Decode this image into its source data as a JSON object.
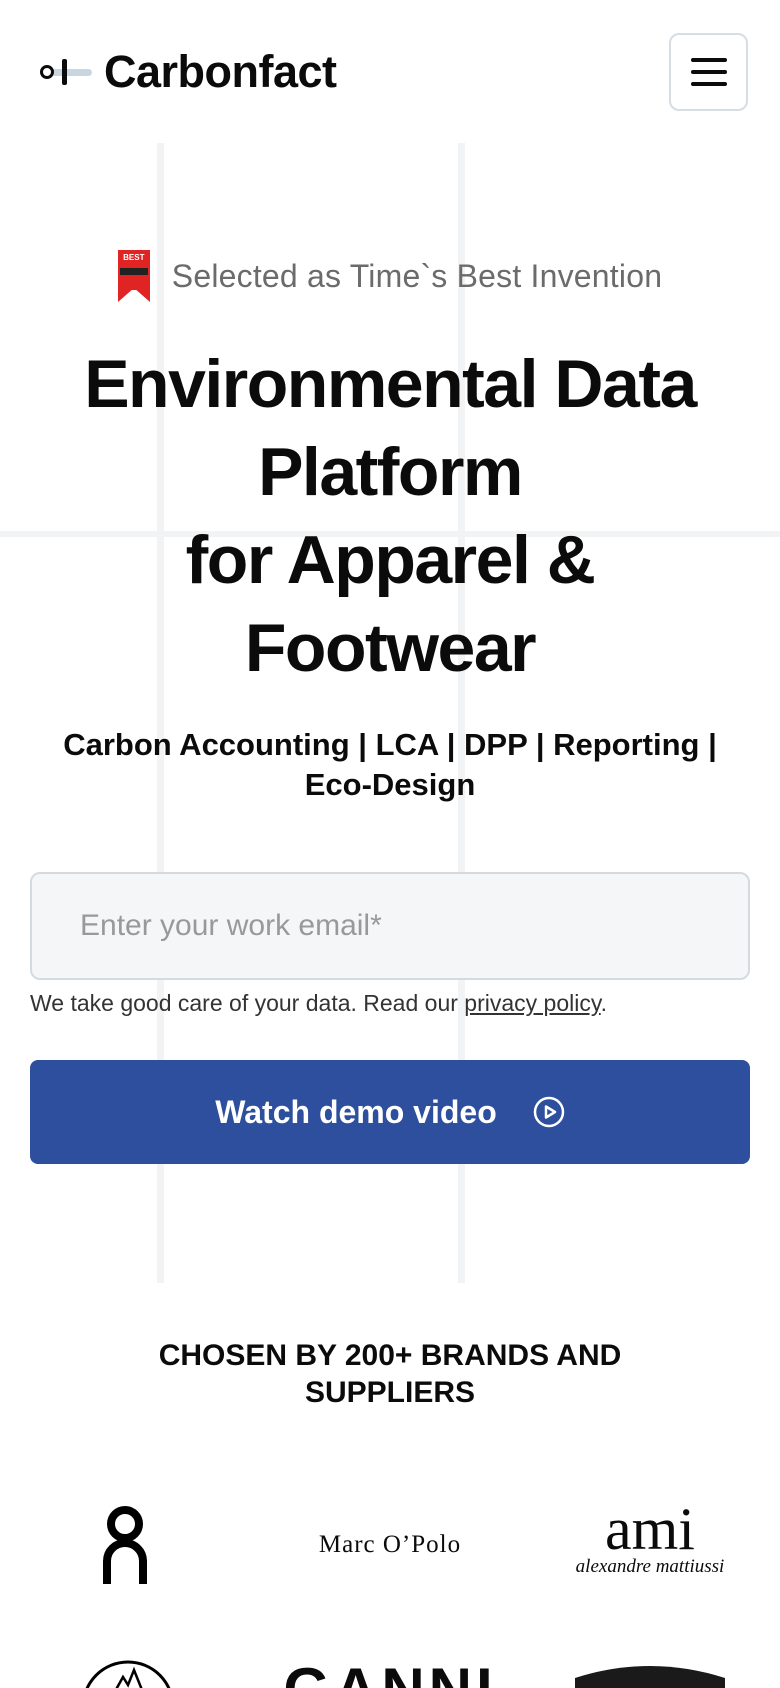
{
  "header": {
    "brand_name": "Carbonfact",
    "menu_icon": "hamburger-menu-icon"
  },
  "hero": {
    "badge_icon_text": "BEST",
    "badge_text": "Selected as Time`s Best Invention",
    "title_lines": [
      "Environmental Data",
      "Platform",
      "for Apparel &",
      "Footwear"
    ],
    "subtitle": "Carbon Accounting | LCA | DPP | Reporting | Eco-Design",
    "email_placeholder": "Enter your work email*",
    "privacy_prefix": "We take good care of your data. Read our ",
    "privacy_link": "privacy policy",
    "privacy_suffix": ".",
    "cta_label": "Watch demo video",
    "cta_icon": "play-circle-icon"
  },
  "brands": {
    "heading": "CHOSEN BY 200+ BRANDS AND SUPPLIERS",
    "logos": [
      {
        "name": "On",
        "text": ""
      },
      {
        "name": "Marc O'Polo",
        "text": "Marc O’Polo"
      },
      {
        "name": "ami",
        "text": "ami",
        "subtext": "alexandre mattiussi"
      },
      {
        "name": "mountain-brand",
        "text": ""
      },
      {
        "name": "Ganni",
        "text": "GANNI"
      },
      {
        "name": "dark-badge-brand",
        "text": ""
      }
    ]
  },
  "colors": {
    "primary_button": "#2d4f9e",
    "logo_accent": "#c9d6df",
    "badge_red": "#e02424"
  }
}
